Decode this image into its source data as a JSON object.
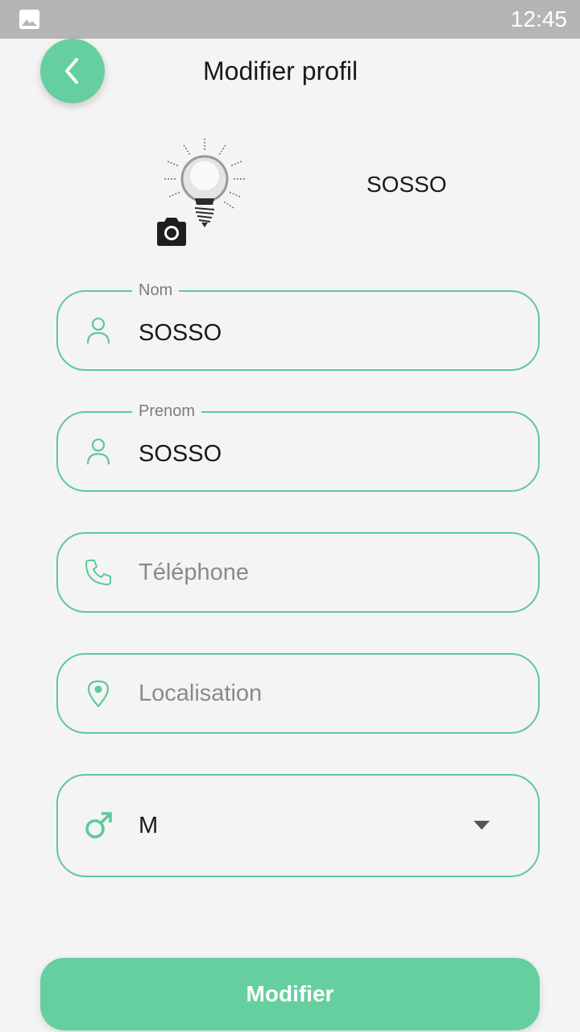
{
  "status_bar": {
    "time": "12:45",
    "left_icon": "image-icon"
  },
  "header": {
    "title": "Modifier profil",
    "back_icon": "chevron-left-icon"
  },
  "profile": {
    "display_name": "SOSSO",
    "avatar_icon": "lightbulb-icon",
    "camera_icon": "camera-icon"
  },
  "form": {
    "nom": {
      "label": "Nom",
      "value": "SOSSO",
      "icon": "person-icon"
    },
    "prenom": {
      "label": "Prenom",
      "value": "SOSSO",
      "icon": "person-icon"
    },
    "telephone": {
      "placeholder": "Téléphone",
      "icon": "phone-icon"
    },
    "localisation": {
      "placeholder": "Localisation",
      "icon": "location-pin-icon"
    },
    "sexe": {
      "value": "M",
      "icon": "male-icon",
      "arrow_icon": "dropdown-arrow-icon"
    }
  },
  "submit": {
    "label": "Modifier"
  },
  "colors": {
    "accent": "#66cfa0",
    "border": "#5ec99a",
    "background": "#f4f4f4",
    "status_bar": "#b5b5b5"
  }
}
